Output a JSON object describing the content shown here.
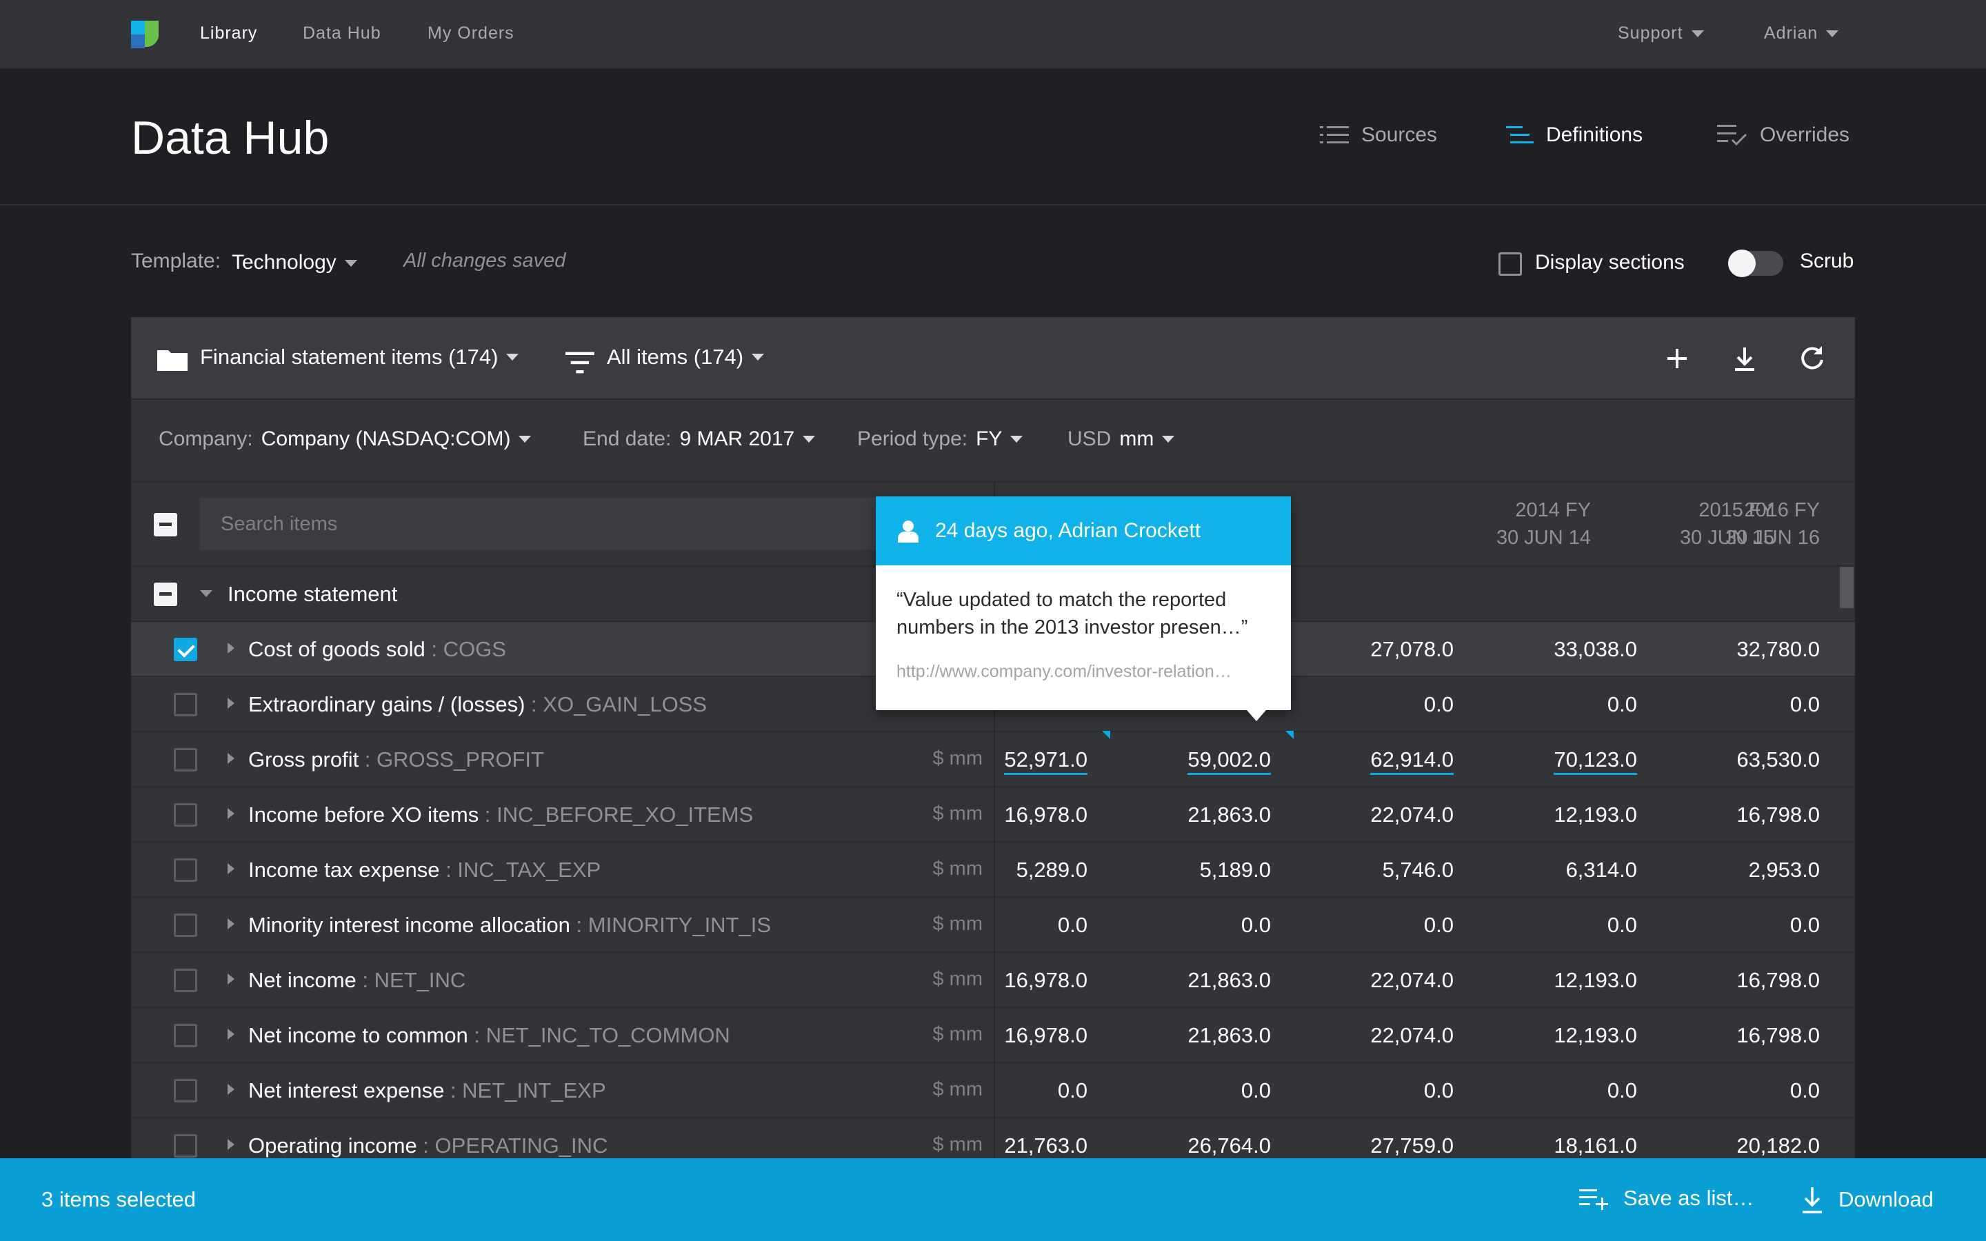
{
  "nav": {
    "links": [
      "Library",
      "Data Hub",
      "My Orders"
    ],
    "support": "Support",
    "user": "Adrian"
  },
  "header": {
    "title": "Data Hub",
    "tabs": [
      {
        "label": "Sources",
        "icon": "list-icon",
        "active": false
      },
      {
        "label": "Definitions",
        "icon": "definitions-icon",
        "active": true
      },
      {
        "label": "Overrides",
        "icon": "overrides-icon",
        "active": false
      }
    ]
  },
  "toolbar": {
    "template_label": "Template:",
    "template_value": "Technology",
    "status": "All changes saved",
    "display_sections": "Display sections",
    "scrub": "Scrub"
  },
  "panel": {
    "folder": "Financial statement items (174)",
    "filter": "All items (174)",
    "actions": [
      "add-icon",
      "download-icon",
      "refresh-icon"
    ]
  },
  "filters": {
    "company_label": "Company:",
    "company_value": "Company (NASDAQ:COM)",
    "end_date_label": "End date:",
    "end_date_value": "9 MAR 2017",
    "period_label": "Period type:",
    "period_value": "FY",
    "currency_label": "USD",
    "currency_value": "mm"
  },
  "table": {
    "search_placeholder": "Search items",
    "columns": [
      {
        "line1": "2014 FY",
        "line2": "30 JUN 14"
      },
      {
        "line1": "2015 FY",
        "line2": "30 JUN 15"
      },
      {
        "line1": "2016 FY",
        "line2": "30 JUN 16"
      }
    ],
    "section": "Income statement",
    "rows": [
      {
        "name": "Cost of goods sold",
        "code": " : COGS",
        "unit": "",
        "checked": true,
        "values": [
          "",
          "",
          "27,078.0",
          "33,038.0",
          "32,780.0"
        ]
      },
      {
        "name": "Extraordinary gains / (losses) ",
        "code": " : XO_GAIN_LOSS",
        "unit": "",
        "checked": false,
        "values": [
          "",
          "",
          "0.0",
          "0.0",
          "0.0"
        ]
      },
      {
        "name": "Gross profit",
        "code": " : GROSS_PROFIT",
        "unit": "$ mm",
        "checked": false,
        "values": [
          "52,971.0",
          "59,002.0",
          "62,914.0",
          "70,123.0",
          "63,530.0"
        ]
      },
      {
        "name": "Income before XO items",
        "code": " : INC_BEFORE_XO_ITEMS",
        "unit": "$ mm",
        "checked": false,
        "values": [
          "16,978.0",
          "21,863.0",
          "22,074.0",
          "12,193.0",
          "16,798.0"
        ]
      },
      {
        "name": "Income tax expense",
        "code": " : INC_TAX_EXP",
        "unit": "$ mm",
        "checked": false,
        "values": [
          "5,289.0",
          "5,189.0",
          "5,746.0",
          "6,314.0",
          "2,953.0"
        ]
      },
      {
        "name": "Minority interest income allocation",
        "code": " : MINORITY_INT_IS",
        "unit": "$ mm",
        "checked": false,
        "values": [
          "0.0",
          "0.0",
          "0.0",
          "0.0",
          "0.0"
        ]
      },
      {
        "name": "Net income",
        "code": " : NET_INC",
        "unit": "$ mm",
        "checked": false,
        "values": [
          "16,978.0",
          "21,863.0",
          "22,074.0",
          "12,193.0",
          "16,798.0"
        ]
      },
      {
        "name": "Net income to common",
        "code": " : NET_INC_TO_COMMON",
        "unit": "$ mm",
        "checked": false,
        "values": [
          "16,978.0",
          "21,863.0",
          "22,074.0",
          "12,193.0",
          "16,798.0"
        ]
      },
      {
        "name": "Net interest expense",
        "code": " : NET_INT_EXP",
        "unit": "$ mm",
        "checked": false,
        "values": [
          "0.0",
          "0.0",
          "0.0",
          "0.0",
          "0.0"
        ]
      },
      {
        "name": "Operating income",
        "code": " : OPERATING_INC",
        "unit": "$ mm",
        "checked": false,
        "values": [
          "21,763.0",
          "26,764.0",
          "27,759.0",
          "18,161.0",
          "20,182.0"
        ]
      }
    ]
  },
  "tooltip": {
    "author": "24 days ago, Adrian Crockett",
    "quote": "“Value updated to match the reported numbers in the 2013 investor presen…”",
    "link": "http://www.company.com/investor-relation…"
  },
  "bottom": {
    "selected": "3 items selected",
    "save": "Save as list…",
    "download": "Download"
  },
  "colors": {
    "accent": "#0fa8e0",
    "background": "#1f2023",
    "panel": "#333438"
  }
}
